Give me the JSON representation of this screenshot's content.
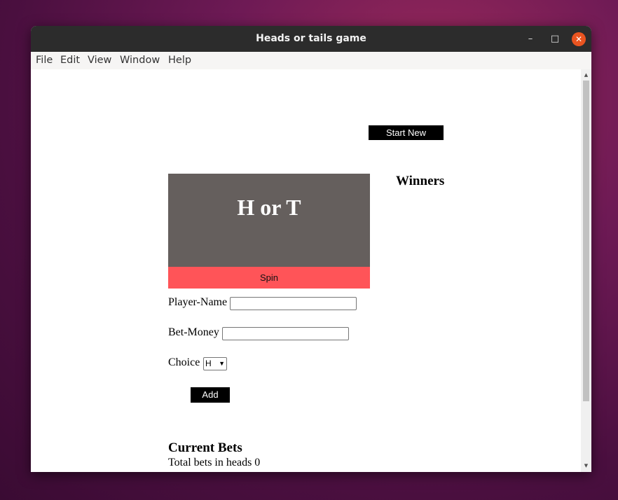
{
  "window": {
    "title": "Heads or tails game",
    "controls": {
      "minimize": "–",
      "maximize": "□",
      "close": "✕"
    }
  },
  "menu": [
    "File",
    "Edit",
    "View",
    "Window",
    "Help"
  ],
  "game": {
    "start_new_label": "Start New",
    "coin_text": "H or T",
    "spin_label": "Spin",
    "winners_heading": "Winners",
    "player_name_label": "Player-Name",
    "player_name_value": "",
    "bet_money_label": "Bet-Money",
    "bet_money_value": "",
    "choice_label": "Choice",
    "choice_selected": "H",
    "add_label": "Add",
    "current_bets_heading": "Current Bets",
    "total_heads_text": "Total bets in heads 0"
  },
  "colors": {
    "coin_bg": "#655f5d",
    "spin_bg": "#ff5458",
    "titlebar_bg": "#2c2c2c",
    "close_btn": "#e95420"
  }
}
